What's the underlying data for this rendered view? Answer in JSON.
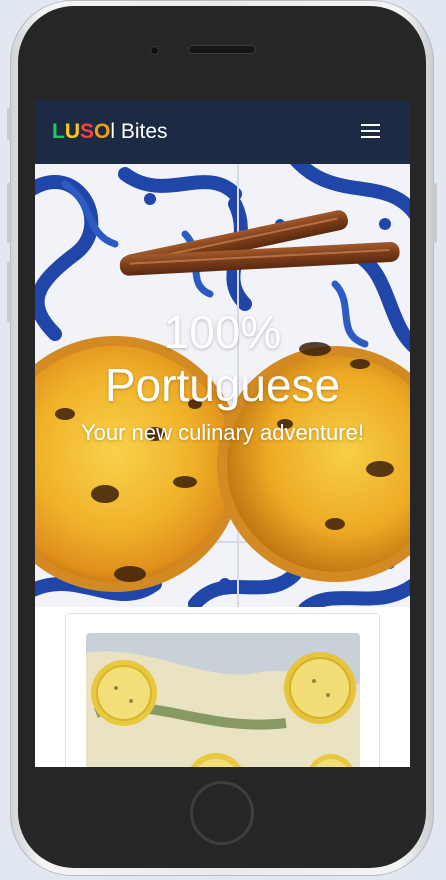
{
  "navbar": {
    "brand_letters": [
      "L",
      "U",
      "S",
      "O"
    ],
    "brand_rest": "l Bites",
    "menu_icon": "hamburger-menu-icon"
  },
  "hero": {
    "title_line1": "100%",
    "title_line2": "Portuguese",
    "subtitle": "Your new culinary adventure!"
  },
  "colors": {
    "navbar_bg": "#1c2a44",
    "brand_letter_colors": [
      "#22c55e",
      "#facc15",
      "#ef4444",
      "#f59e0b"
    ],
    "tile_blue": "#1f46a8",
    "background": "#e2e8f1"
  }
}
